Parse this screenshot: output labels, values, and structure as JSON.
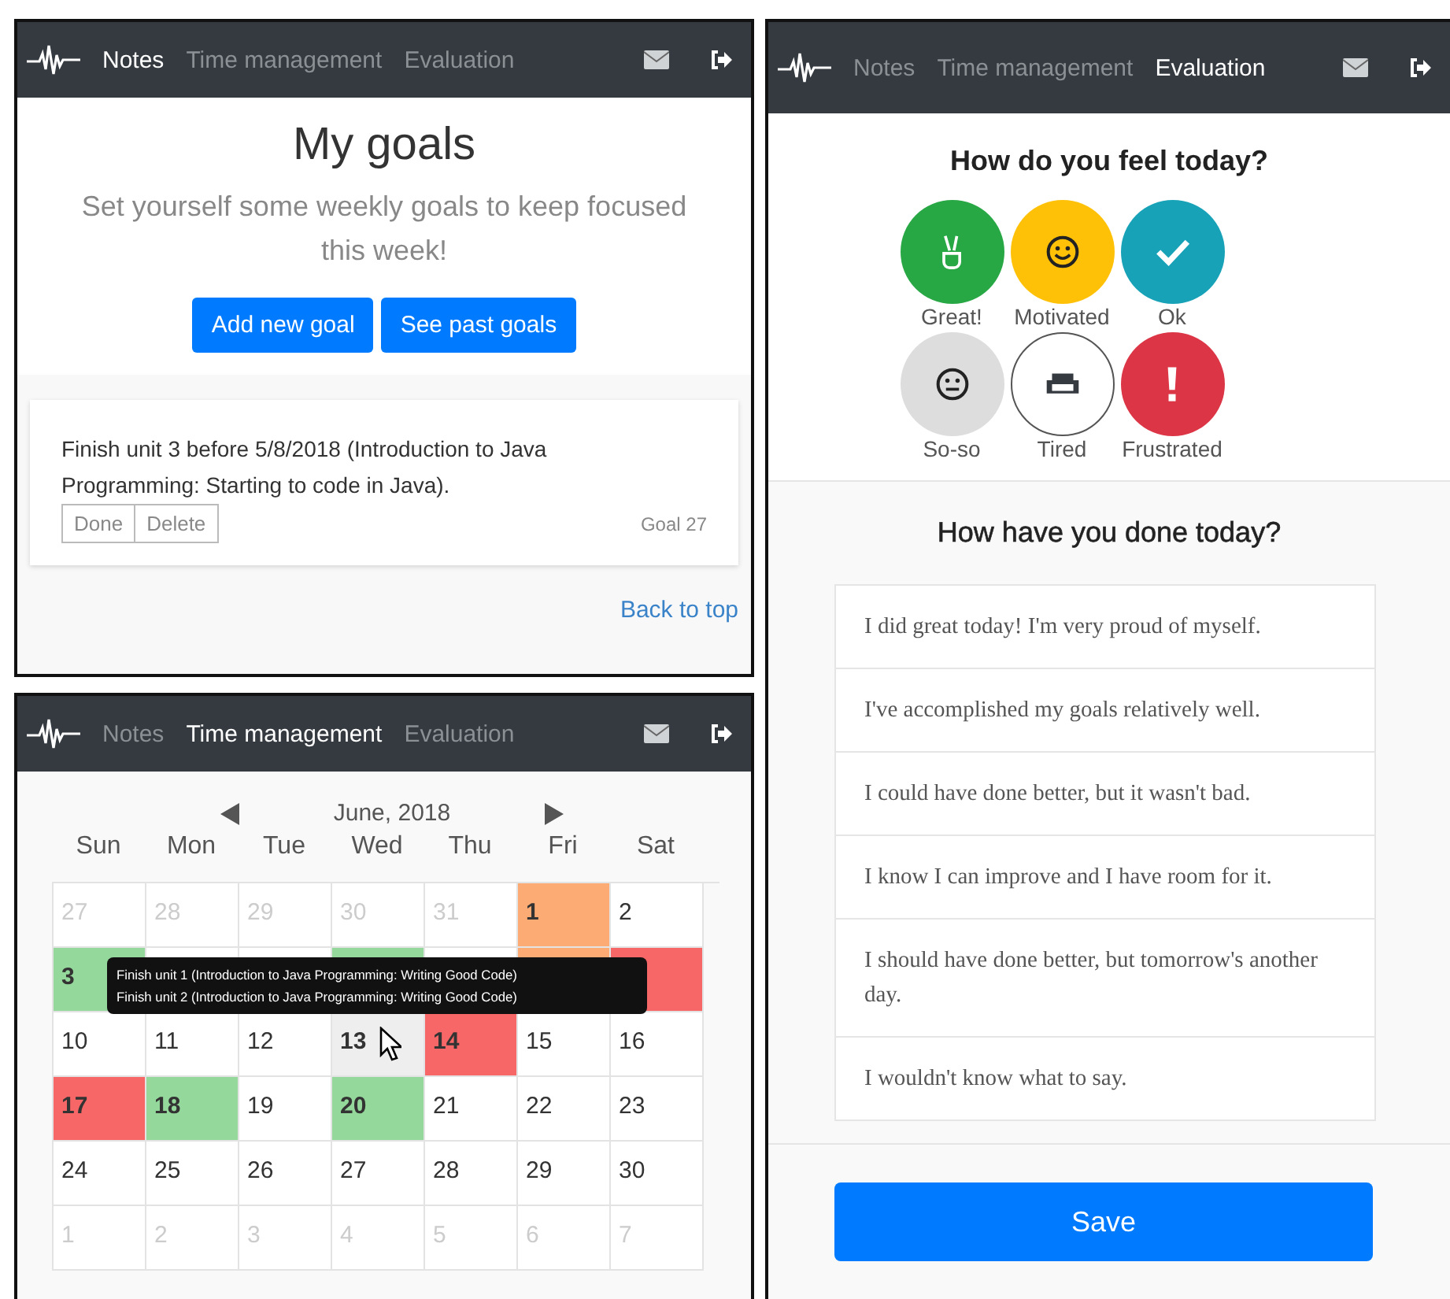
{
  "goals_screen": {
    "nav": [
      {
        "label": "Notes",
        "selected": true
      },
      {
        "label": "Time management",
        "selected": false
      },
      {
        "label": "Evaluation",
        "selected": false
      }
    ],
    "title": "My goals",
    "subtitle": "Set yourself some weekly goals to keep focused this week!",
    "buttons": [
      "Add new goal",
      "See past goals"
    ],
    "goal": {
      "text": "Finish unit 3 before 5/8/2018 (Introduction to Java Programming: Starting to code in Java).",
      "actions": [
        "Done",
        "Delete"
      ],
      "number": "Goal 27"
    },
    "back_link": "Back to top"
  },
  "calendar_screen": {
    "nav": [
      {
        "label": "Notes",
        "selected": false
      },
      {
        "label": "Time management",
        "selected": true
      },
      {
        "label": "Evaluation",
        "selected": false
      }
    ],
    "month": "June, 2018",
    "weekdays": [
      "Sun",
      "Mon",
      "Tue",
      "Wed",
      "Thu",
      "Fri",
      "Sat"
    ],
    "weeks": [
      [
        {
          "day": "27",
          "kind": "other"
        },
        {
          "day": "28",
          "kind": "other"
        },
        {
          "day": "29",
          "kind": "other"
        },
        {
          "day": "30",
          "kind": "other"
        },
        {
          "day": "31",
          "kind": "other"
        },
        {
          "day": "1",
          "kind": "goal",
          "color": "#fdab74"
        },
        {
          "day": "2",
          "kind": "plain"
        }
      ],
      [
        {
          "day": "3",
          "kind": "goal",
          "color": "#94d89b"
        },
        {
          "kind": "plain"
        },
        {
          "kind": "plain"
        },
        {
          "kind": "goal",
          "color": "#94d89b"
        },
        {
          "kind": "plain"
        },
        {
          "kind": "goal",
          "color": "#fdab74"
        },
        {
          "kind": "goal",
          "color": "#f86767"
        }
      ],
      [
        {
          "day": "10",
          "kind": "plain"
        },
        {
          "day": "11",
          "kind": "plain"
        },
        {
          "day": "12",
          "kind": "plain"
        },
        {
          "day": "13",
          "kind": "hovered"
        },
        {
          "day": "14",
          "kind": "goal",
          "color": "#f86767"
        },
        {
          "day": "15",
          "kind": "plain"
        },
        {
          "day": "16",
          "kind": "plain"
        }
      ],
      [
        {
          "day": "17",
          "kind": "goal",
          "color": "#f86767"
        },
        {
          "day": "18",
          "kind": "goal",
          "color": "#94d89b"
        },
        {
          "day": "19",
          "kind": "plain"
        },
        {
          "day": "20",
          "kind": "goal",
          "color": "#94d89b"
        },
        {
          "day": "21",
          "kind": "plain"
        },
        {
          "day": "22",
          "kind": "plain"
        },
        {
          "day": "23",
          "kind": "plain"
        }
      ],
      [
        {
          "day": "24",
          "kind": "plain"
        },
        {
          "day": "25",
          "kind": "plain"
        },
        {
          "day": "26",
          "kind": "plain"
        },
        {
          "day": "27",
          "kind": "plain"
        },
        {
          "day": "28",
          "kind": "plain"
        },
        {
          "day": "29",
          "kind": "plain"
        },
        {
          "day": "30",
          "kind": "plain"
        }
      ],
      [
        {
          "day": "1",
          "kind": "other"
        },
        {
          "day": "2",
          "kind": "other"
        },
        {
          "day": "3",
          "kind": "other"
        },
        {
          "day": "4",
          "kind": "other"
        },
        {
          "day": "5",
          "kind": "other"
        },
        {
          "day": "6",
          "kind": "other"
        },
        {
          "day": "7",
          "kind": "other"
        }
      ]
    ],
    "tooltip": [
      "Finish unit 1 (Introduction to Java Programming: Writing Good Code)",
      "Finish unit 2 (Introduction to Java Programming: Writing Good Code)"
    ]
  },
  "evaluation_screen": {
    "nav": [
      {
        "label": "Notes",
        "selected": false
      },
      {
        "label": "Time management",
        "selected": false
      },
      {
        "label": "Evaluation",
        "selected": true
      }
    ],
    "feel_title": "How do you feel today?",
    "moods": [
      {
        "label": "Great!",
        "kind": "peace",
        "color": "#28a745",
        "selected": false
      },
      {
        "label": "Motivated",
        "kind": "smile",
        "color": "#ffc107",
        "selected": false
      },
      {
        "label": "Ok",
        "kind": "check",
        "color": "#17a2b8",
        "selected": false
      },
      {
        "label": "So-so",
        "kind": "neutral",
        "color": "#dddddd",
        "selected": false
      },
      {
        "label": "Tired",
        "kind": "couch",
        "color": "#343a40",
        "selected": true
      },
      {
        "label": "Frustrated",
        "kind": "exclamation",
        "color": "#dc3545",
        "selected": false
      }
    ],
    "done_title": "How have you done today?",
    "answers": [
      "I did great today! I'm very proud of myself.",
      "I've accomplished my goals relatively well.",
      "I could have done better, but it wasn't bad.",
      "I know I can improve and I have room for it.",
      "I should have done better, but tomorrow's another day.",
      "I wouldn't know what to say."
    ],
    "save": "Save"
  }
}
